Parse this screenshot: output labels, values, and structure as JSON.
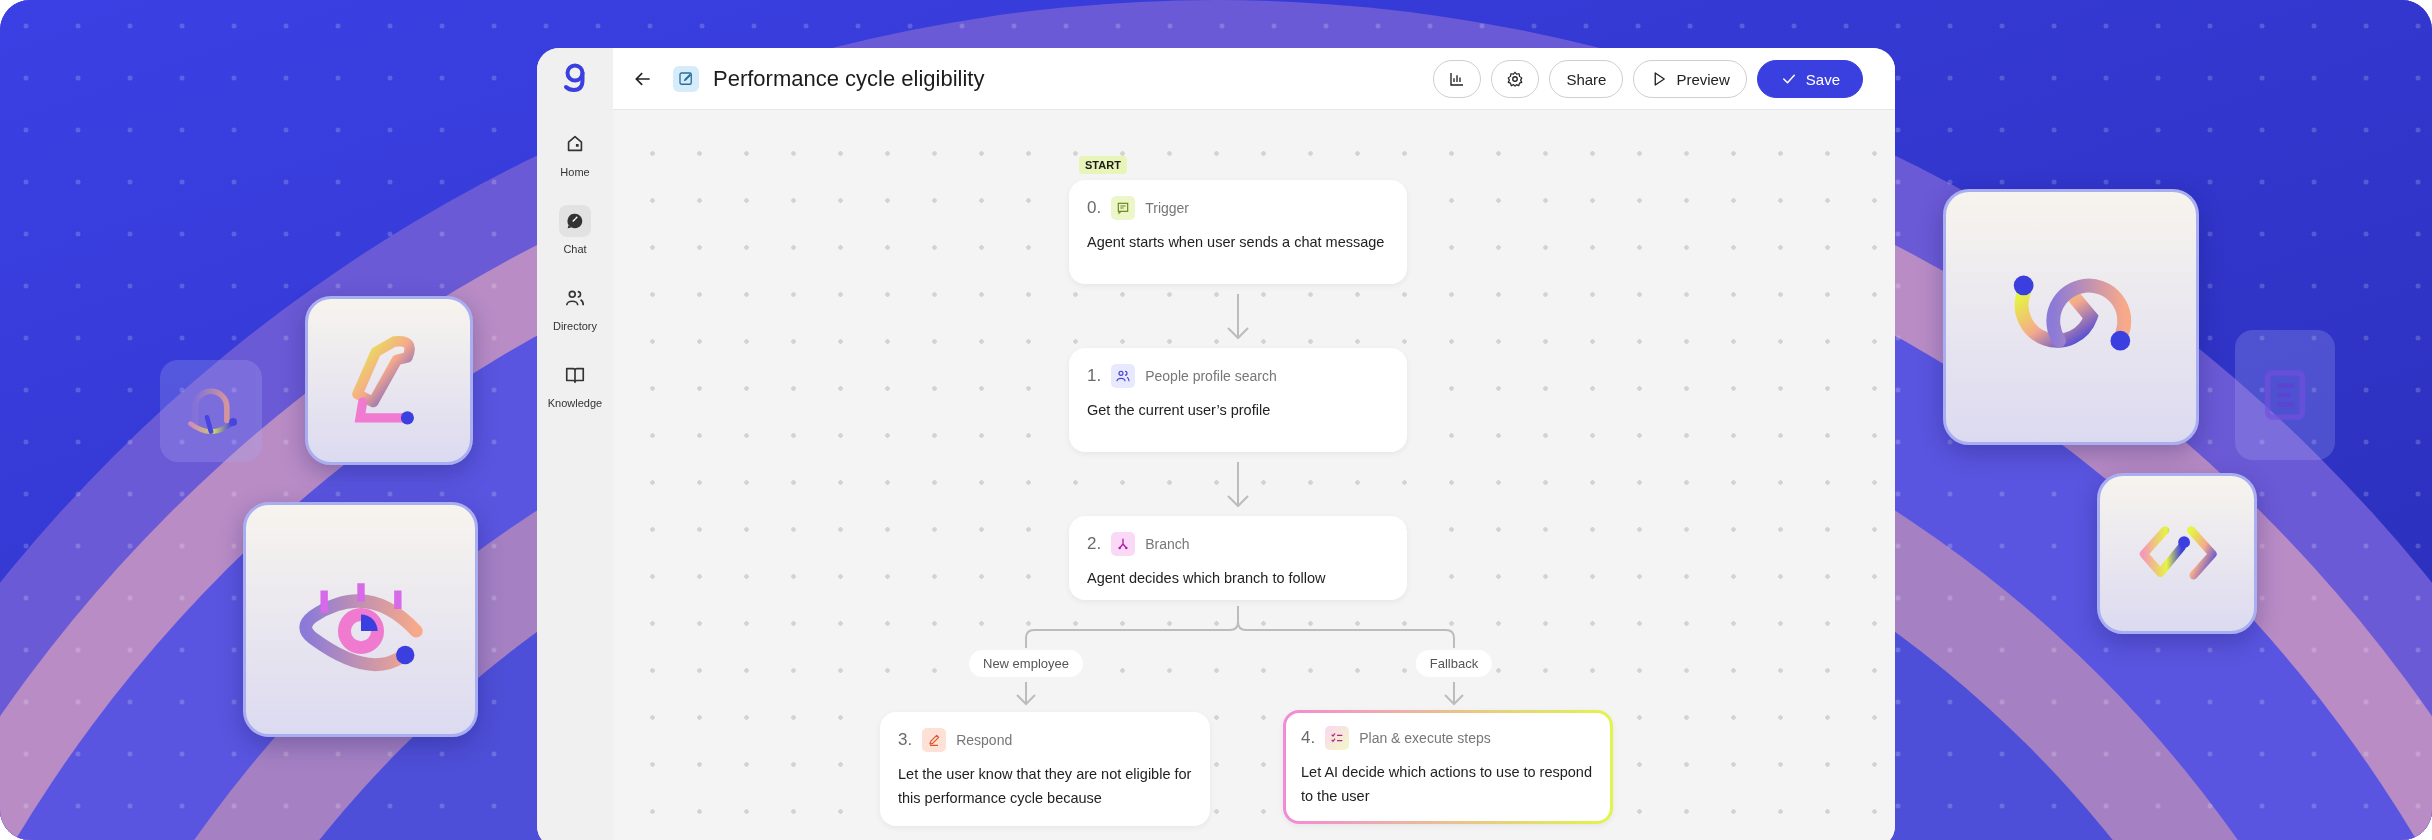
{
  "sidebar": {
    "items": [
      {
        "kind": "home",
        "label": "Home",
        "selected": false
      },
      {
        "kind": "chat",
        "label": "Chat",
        "selected": true
      },
      {
        "kind": "directory",
        "label": "Directory",
        "selected": false
      },
      {
        "kind": "knowledge",
        "label": "Knowledge",
        "selected": false
      }
    ]
  },
  "header": {
    "title": "Performance cycle eligibility",
    "buttons": [
      {
        "kind": "chart"
      },
      {
        "kind": "settings"
      },
      {
        "kind": "plain",
        "label": "Share"
      },
      {
        "kind": "preview",
        "label": "Preview"
      },
      {
        "kind": "save",
        "label": "Save"
      }
    ]
  },
  "flow": {
    "start_label": "START",
    "steps": [
      {
        "number": "0.",
        "kind": "trigger",
        "title": "Trigger",
        "description": "Agent starts when user sends a chat message",
        "selected": false
      },
      {
        "number": "1.",
        "kind": "people",
        "title": "People profile search",
        "description": "Get the current user’s profile",
        "selected": false
      },
      {
        "number": "2.",
        "kind": "branch",
        "title": "Branch",
        "description": "Agent decides which branch to follow",
        "selected": false
      },
      {
        "number": "3.",
        "kind": "respond",
        "title": "Respond",
        "description": "Let the user know that they are not eligible for this performance cycle because",
        "selected": false
      },
      {
        "number": "4.",
        "kind": "plan",
        "title": "Plan & execute steps",
        "description": "Let AI decide which actions to use to respond to the user",
        "selected": true
      }
    ],
    "branches": [
      {
        "label": "New employee"
      },
      {
        "label": "Fallback"
      }
    ]
  }
}
